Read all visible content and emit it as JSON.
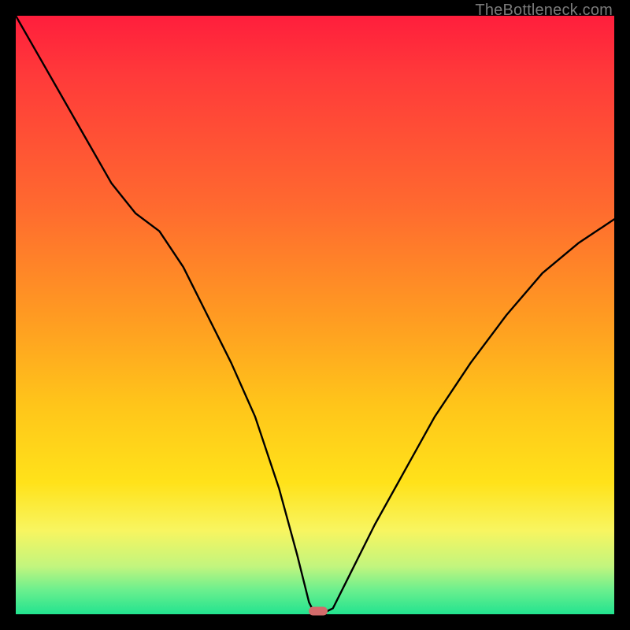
{
  "watermark": "TheBottleneck.com",
  "colors": {
    "background": "#000000",
    "gradient_top": "#ff1e3c",
    "gradient_bottom": "#22e38f",
    "curve": "#000000",
    "marker": "#d36b6b"
  },
  "chart_data": {
    "type": "line",
    "title": "",
    "xlabel": "",
    "ylabel": "",
    "xlim": [
      0,
      100
    ],
    "ylim": [
      0,
      100
    ],
    "series": [
      {
        "name": "bottleneck-curve",
        "x": [
          0,
          4,
          8,
          12,
          16,
          20,
          24,
          28,
          32,
          36,
          40,
          44,
          47,
          49,
          50,
          51,
          53,
          56,
          60,
          65,
          70,
          76,
          82,
          88,
          94,
          100
        ],
        "y": [
          100,
          93,
          86,
          79,
          72,
          67,
          64,
          58,
          50,
          42,
          33,
          21,
          10,
          2,
          0,
          0,
          1,
          7,
          15,
          24,
          33,
          42,
          50,
          57,
          62,
          66
        ]
      }
    ],
    "annotations": [
      {
        "name": "min-marker",
        "x": 50.5,
        "y": 0.5
      }
    ]
  }
}
